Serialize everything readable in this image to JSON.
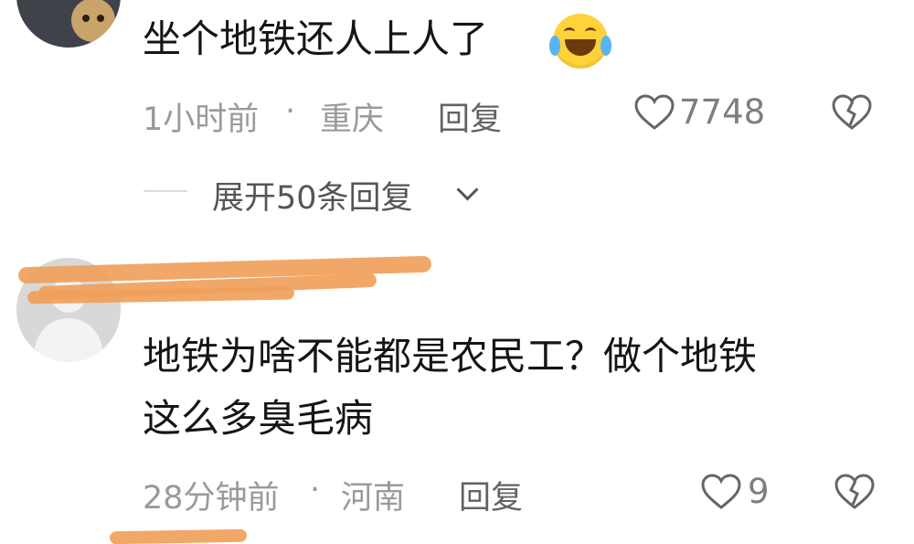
{
  "comments": [
    {
      "text": "坐个地铁还人上人了",
      "emoji": "crying-laughing-emoji",
      "time": "1小时前",
      "separator": "·",
      "location": "重庆",
      "reply_label": "回复",
      "likes": "7748",
      "expand_label": "展开50条回复"
    },
    {
      "text_line1": "地铁为啥不能都是农民工？做个地铁",
      "text_line2": "这么多臭毛病",
      "time": "28分钟前",
      "separator": "·",
      "location": "河南",
      "reply_label": "回复",
      "likes": "9",
      "username_redaction_color": "#f0a05a"
    }
  ],
  "icons": {
    "like": "heart-outline-icon",
    "dislike": "broken-heart-icon",
    "expand": "chevron-down-icon"
  }
}
